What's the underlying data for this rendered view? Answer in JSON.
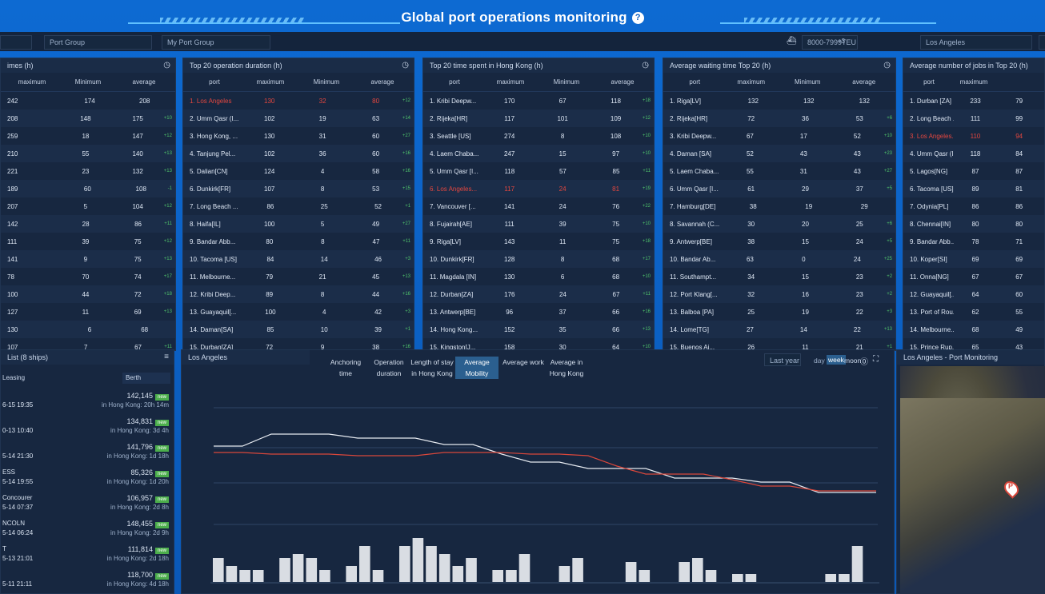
{
  "app": {
    "title": "Global port operations monitoring"
  },
  "toolbar": {
    "port_group_select": "Port Group",
    "my_port_group": "My Port Group",
    "teu_select": "8000-7999TEU",
    "teu_extra": "+3",
    "port_select": "Los Angeles"
  },
  "cards": [
    {
      "title": "imes (h)",
      "cols": [
        "maximum",
        "Minimum",
        "average"
      ],
      "rows": [
        [
          "242",
          "174",
          "208",
          ""
        ],
        [
          "208",
          "148",
          "175",
          "+10"
        ],
        [
          "259",
          "18",
          "147",
          "+12"
        ],
        [
          "210",
          "55",
          "140",
          "+13"
        ],
        [
          "221",
          "23",
          "132",
          "+13"
        ],
        [
          "189",
          "60",
          "108",
          "-1"
        ],
        [
          "207",
          "5",
          "104",
          "+12"
        ],
        [
          "142",
          "28",
          "86",
          "+11"
        ],
        [
          "111",
          "39",
          "75",
          "+12"
        ],
        [
          "141",
          "9",
          "75",
          "+13"
        ],
        [
          "78",
          "70",
          "74",
          "+17"
        ],
        [
          "100",
          "44",
          "72",
          "+18"
        ],
        [
          "127",
          "11",
          "69",
          "+13"
        ],
        [
          "130",
          "6",
          "68",
          ""
        ],
        [
          "107",
          "7",
          "67",
          "+11"
        ]
      ]
    },
    {
      "title": "Top 20 operation duration (h)",
      "cols": [
        "port",
        "maximum",
        "Minimum",
        "average"
      ],
      "rows": [
        [
          "1. Los Angeles",
          "130",
          "32",
          "80",
          "+12"
        ],
        [
          "2. Umm Qasr (I...",
          "102",
          "19",
          "63",
          "+14"
        ],
        [
          "3. Hong Kong, ...",
          "130",
          "31",
          "60",
          "+27"
        ],
        [
          "4. Tanjung Pel...",
          "102",
          "36",
          "60",
          "+16"
        ],
        [
          "5. Dalian[CN]",
          "124",
          "4",
          "58",
          "+16"
        ],
        [
          "6. Dunkirk[FR]",
          "107",
          "8",
          "53",
          "+15"
        ],
        [
          "7. Long Beach ...",
          "86",
          "25",
          "52",
          "+1"
        ],
        [
          "8. Haifa[IL]",
          "100",
          "5",
          "49",
          "+27"
        ],
        [
          "9. Bandar Abb...",
          "80",
          "8",
          "47",
          "+11"
        ],
        [
          "10. Tacoma [US]",
          "84",
          "14",
          "46",
          "+3"
        ],
        [
          "11. Melbourne...",
          "79",
          "21",
          "45",
          "+13"
        ],
        [
          "12. Kribi Deep...",
          "89",
          "8",
          "44",
          "+16"
        ],
        [
          "13. Guayaquil[...",
          "100",
          "4",
          "42",
          "+3"
        ],
        [
          "14. Daman[SA]",
          "85",
          "10",
          "39",
          "+1"
        ],
        [
          "15. Durban[ZA]",
          "72",
          "9",
          "38",
          "+16"
        ]
      ]
    },
    {
      "title": "Top 20 time spent in Hong Kong (h)",
      "cols": [
        "port",
        "maximum",
        "Minimum",
        "average"
      ],
      "rows": [
        [
          "1. Kribi Deepw...",
          "170",
          "67",
          "118",
          "+18"
        ],
        [
          "2. Rijeka[HR]",
          "117",
          "101",
          "109",
          "+12"
        ],
        [
          "3. Seattle [US]",
          "274",
          "8",
          "108",
          "+10"
        ],
        [
          "4. Laem Chaba...",
          "247",
          "15",
          "97",
          "+10"
        ],
        [
          "5. Umm Qasr [I...",
          "118",
          "57",
          "85",
          "+11"
        ],
        [
          "6. Los Angeles...",
          "117",
          "24",
          "81",
          "+19"
        ],
        [
          "7. Vancouver [...",
          "141",
          "24",
          "76",
          "+22"
        ],
        [
          "8. Fujairah[AE]",
          "111",
          "39",
          "75",
          "+10"
        ],
        [
          "9. Riga[LV]",
          "143",
          "11",
          "75",
          "+18"
        ],
        [
          "10. Dunkirk[FR]",
          "128",
          "8",
          "68",
          "+17"
        ],
        [
          "11. Magdala [IN]",
          "130",
          "6",
          "68",
          "+10"
        ],
        [
          "12. Durban[ZA]",
          "176",
          "24",
          "67",
          "+11"
        ],
        [
          "13. Antwerp[BE]",
          "96",
          "37",
          "66",
          "+16"
        ],
        [
          "14. Hong Kong...",
          "152",
          "35",
          "66",
          "+13"
        ],
        [
          "15. Kingston[J...",
          "158",
          "30",
          "64",
          "+10"
        ]
      ]
    },
    {
      "title": "Average waiting time Top 20 (h)",
      "cols": [
        "port",
        "maximum",
        "Minimum",
        "average"
      ],
      "rows": [
        [
          "1. Riga[LV]",
          "132",
          "132",
          "132",
          ""
        ],
        [
          "2. Rijeka[HR]",
          "72",
          "36",
          "53",
          "+6"
        ],
        [
          "3. Kribi Deepw...",
          "67",
          "17",
          "52",
          "+10"
        ],
        [
          "4. Daman [SA]",
          "52",
          "43",
          "43",
          "+23"
        ],
        [
          "5. Laem Chaba...",
          "55",
          "31",
          "43",
          "+27"
        ],
        [
          "6. Umm Qasr [I...",
          "61",
          "29",
          "37",
          "+5"
        ],
        [
          "7. Hamburg[DE]",
          "38",
          "19",
          "29",
          ""
        ],
        [
          "8. Savannah (C...",
          "30",
          "20",
          "25",
          "+6"
        ],
        [
          "9. Antwerp[BE]",
          "38",
          "15",
          "24",
          "+5"
        ],
        [
          "10. Bandar Ab...",
          "63",
          "0",
          "24",
          "+25"
        ],
        [
          "11. Southampt...",
          "34",
          "15",
          "23",
          "+2"
        ],
        [
          "12. Port Klang[...",
          "32",
          "16",
          "23",
          "+2"
        ],
        [
          "13. Balboa [PA]",
          "25",
          "19",
          "22",
          "+3"
        ],
        [
          "14. Lome[TG]",
          "27",
          "14",
          "22",
          "+13"
        ],
        [
          "15. Buenos Ai...",
          "26",
          "11",
          "21",
          "+1"
        ]
      ]
    },
    {
      "title": "Average number of jobs in Top 20 (h)",
      "cols": [
        "port",
        "maximum",
        ""
      ],
      "rows": [
        [
          "1. Durban [ZA]",
          "233",
          "79"
        ],
        [
          "2. Long Beach ...",
          "111",
          "99"
        ],
        [
          "3. Los Angeles...",
          "110",
          "94"
        ],
        [
          "4. Umm Qasr (I...",
          "118",
          "84"
        ],
        [
          "5. Lagos[NG]",
          "87",
          "87"
        ],
        [
          "6. Tacoma [US]",
          "89",
          "81"
        ],
        [
          "7. Odynia[PL]",
          "86",
          "86"
        ],
        [
          "8. Chennai[IN]",
          "80",
          "80"
        ],
        [
          "9. Bandar Abb...",
          "78",
          "71"
        ],
        [
          "10. Koper[SI]",
          "69",
          "69"
        ],
        [
          "11. Onna[NG]",
          "67",
          "67"
        ],
        [
          "12. Guayaquil[...",
          "64",
          "60"
        ],
        [
          "13. Port of Rou...",
          "62",
          "55"
        ],
        [
          "14. Melbourne...",
          "68",
          "49"
        ],
        [
          "15. Prince Rup...",
          "65",
          "43"
        ]
      ]
    }
  ],
  "shiplist": {
    "title": "List (8 ships)",
    "col1": "Leasing",
    "col2": "Berth",
    "items": [
      {
        "name": "",
        "time": "6-15 19:35",
        "num": "142,145",
        "dur": "in Hong Kong: 20h 14m"
      },
      {
        "name": "",
        "time": "0-13 10:40",
        "num": "134,831",
        "dur": "in Hong Kong: 3d 4h"
      },
      {
        "name": "",
        "time": "5-14 21:30",
        "num": "141,796",
        "dur": "in Hong Kong: 1d 18h"
      },
      {
        "name": "ESS",
        "time": "5-14 19:55",
        "num": "85,326",
        "dur": "in Hong Kong: 1d 20h"
      },
      {
        "name": "Concourer",
        "time": "5-14 07:37",
        "num": "106,957",
        "dur": "in Hong Kong: 2d 8h"
      },
      {
        "name": "NCOLN",
        "time": "5-14 06:24",
        "num": "148,455",
        "dur": "in Hong Kong: 2d 9h"
      },
      {
        "name": "T",
        "time": "5-13 21:01",
        "num": "111,814",
        "dur": "in Hong Kong: 2d 18h"
      },
      {
        "name": "",
        "time": "5-11 21:11",
        "num": "118,700",
        "dur": "in Hong Kong: 4d 18h"
      }
    ],
    "badge": "new"
  },
  "chart": {
    "title": "Los Angeles",
    "tabs": [
      "Anchoring time",
      "Operation duration",
      "Length of stay in Hong Kong",
      "Average Mobility",
      "Average work",
      "Average in Hong Kong"
    ],
    "range_select": "Last year",
    "range_day": "day",
    "range_week": "week",
    "range_month": "moon",
    "colors": {
      "red": "#d9473b",
      "white": "#e6eaf0"
    }
  },
  "chart_data": {
    "type": "line",
    "series": [
      {
        "values": [
          70,
          70,
          85,
          85,
          85,
          80,
          80,
          80,
          72,
          72,
          60,
          50,
          50,
          42,
          42,
          42,
          30,
          30,
          30,
          25,
          25,
          12,
          12,
          12
        ]
      },
      {
        "values": [
          62,
          62,
          60,
          60,
          60,
          58,
          58,
          58,
          62,
          62,
          62,
          60,
          60,
          58,
          45,
          35,
          35,
          35,
          28,
          20,
          20,
          14,
          14,
          14
        ]
      }
    ],
    "bars": [
      30,
      20,
      15,
      15,
      0,
      30,
      35,
      30,
      15,
      0,
      20,
      45,
      15,
      0,
      45,
      55,
      45,
      35,
      20,
      30,
      0,
      15,
      15,
      35,
      0,
      0,
      20,
      30,
      0,
      0,
      0,
      25,
      15,
      0,
      0,
      25,
      30,
      15,
      0,
      10,
      10,
      0,
      0,
      0,
      0,
      0,
      10,
      10,
      45,
      0
    ]
  },
  "map": {
    "title": "Los Angeles - Port Monitoring",
    "marker": "P"
  }
}
